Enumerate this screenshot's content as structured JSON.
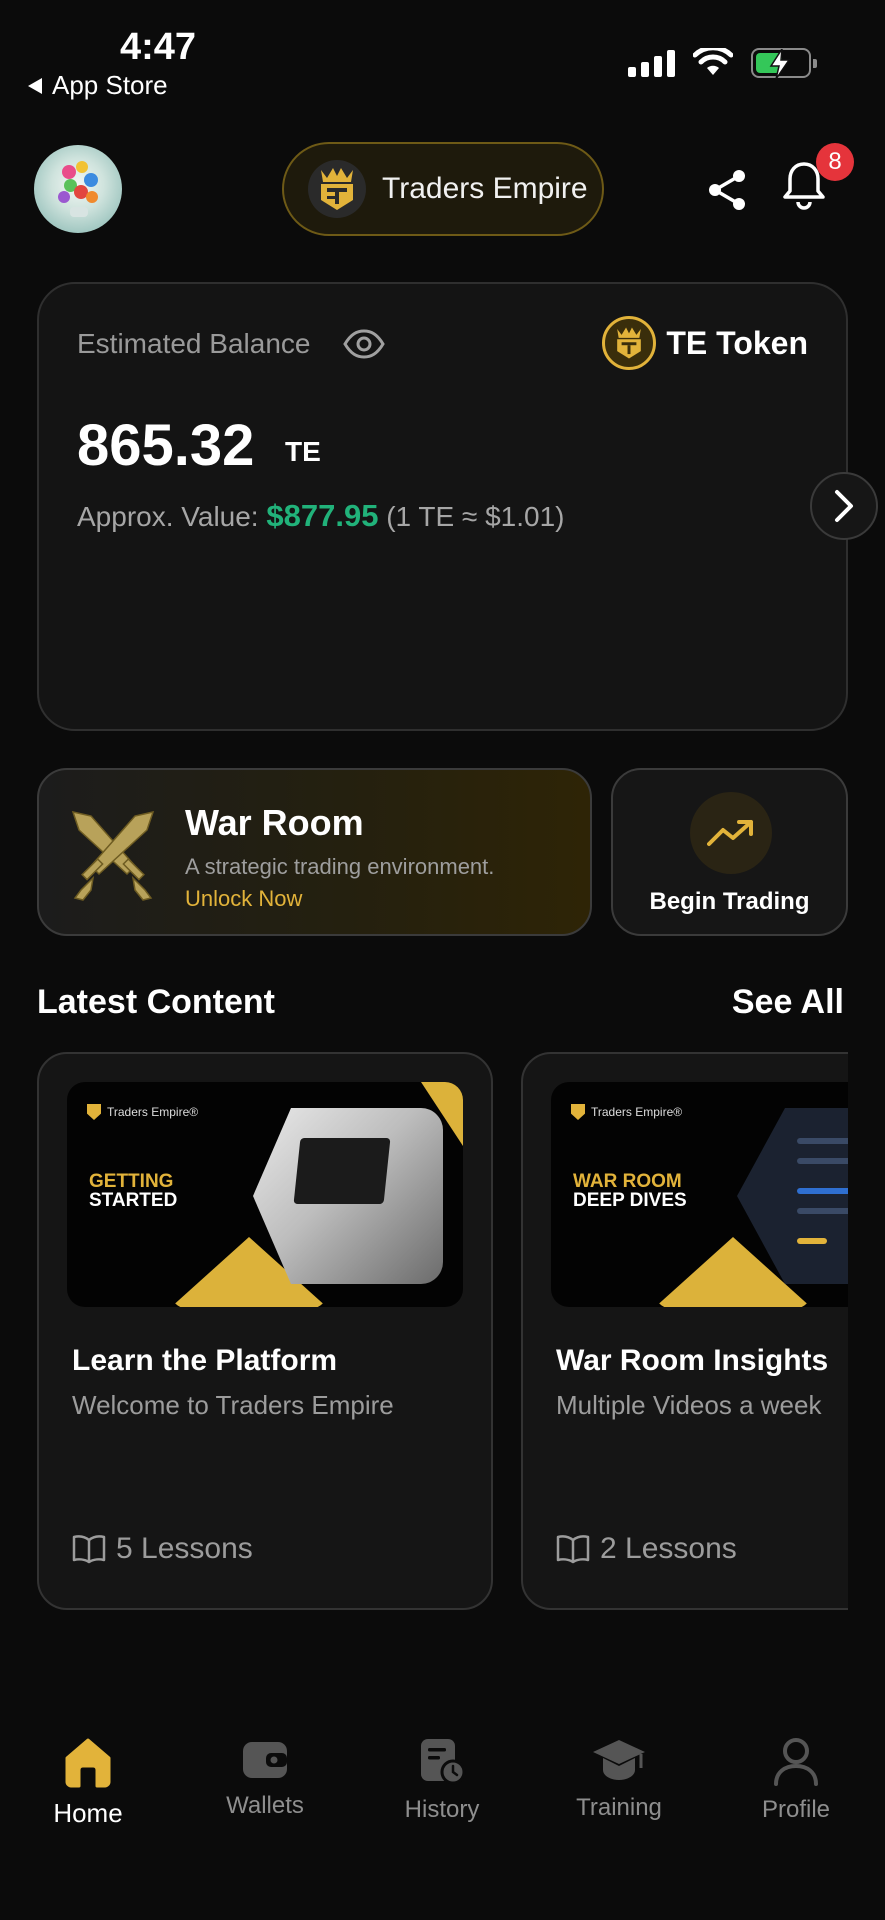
{
  "status_bar": {
    "time": "4:47",
    "back_label": "App Store"
  },
  "header": {
    "brand_name": "Traders Empire",
    "notification_count": "8"
  },
  "balance": {
    "label": "Estimated Balance",
    "token_name": "TE Token",
    "amount": "865.32",
    "unit": "TE",
    "approx_prefix": "Approx. Value:",
    "approx_usd": "$877.95",
    "approx_rate": "(1 TE ≈ $1.01)"
  },
  "war_room": {
    "title": "War Room",
    "subtitle": "A strategic trading environment.",
    "cta": "Unlock Now"
  },
  "begin_trading": {
    "label": "Begin Trading"
  },
  "latest_content": {
    "title": "Latest Content",
    "see_all": "See All",
    "cards": [
      {
        "thumb_brand": "Traders Empire®",
        "thumb_line1": "GETTING",
        "thumb_line2": "STARTED",
        "title": "Learn the Platform",
        "subtitle": "Welcome to Traders Empire",
        "lessons": "5 Lessons"
      },
      {
        "thumb_brand": "Traders Empire®",
        "thumb_line1": "WAR ROOM",
        "thumb_line2": "DEEP DIVES",
        "title": "War Room Insights",
        "subtitle": "Multiple Videos a week",
        "lessons": "2 Lessons"
      }
    ]
  },
  "nav": {
    "items": [
      {
        "label": "Home",
        "icon": "home-icon",
        "active": true
      },
      {
        "label": "Wallets",
        "icon": "wallet-icon",
        "active": false
      },
      {
        "label": "History",
        "icon": "history-icon",
        "active": false
      },
      {
        "label": "Training",
        "icon": "graduation-cap-icon",
        "active": false
      },
      {
        "label": "Profile",
        "icon": "profile-icon",
        "active": false
      }
    ]
  },
  "colors": {
    "accent_gold": "#e2b33a",
    "positive_green": "#21b27a",
    "badge_red": "#e5343b",
    "background": "#0b0b0b"
  }
}
